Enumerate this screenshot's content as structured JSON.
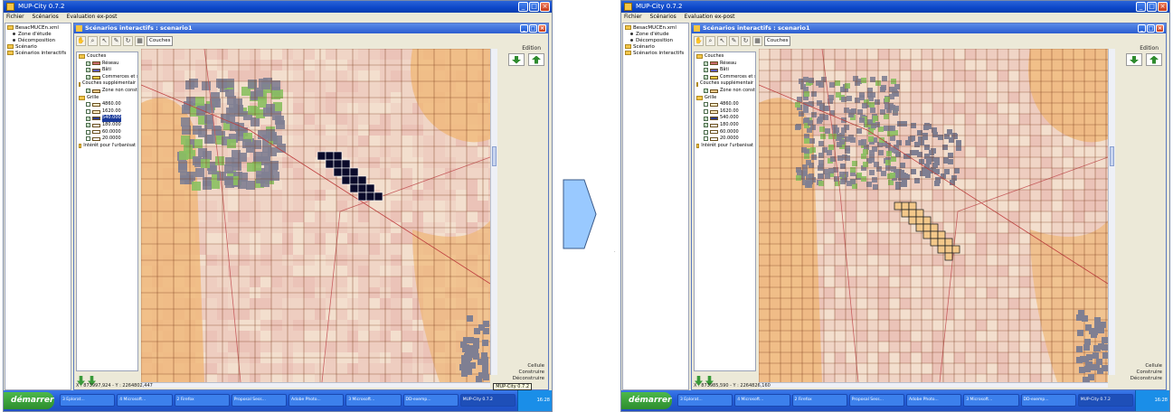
{
  "app": {
    "title": "MUP-City 0.7.2",
    "menu": [
      "Fichier",
      "Scénarios",
      "Evaluation ex-post"
    ]
  },
  "tree": [
    {
      "kind": "folder",
      "label": "BesacMUCEn.xml"
    },
    {
      "kind": "item",
      "label": "Zone d'étude"
    },
    {
      "kind": "item",
      "label": "Décomposition"
    },
    {
      "kind": "folder",
      "label": "Scénario"
    },
    {
      "kind": "folder",
      "label": "Scénarios interactifs"
    }
  ],
  "inner_window": {
    "title": "Scénarios interactifs : scenario1"
  },
  "toolbar": {
    "couches_label": "Couches"
  },
  "layers": [
    {
      "label": "Couches",
      "check": "none",
      "swatch": "folder"
    },
    {
      "label": "Réseau",
      "check": "on",
      "swatch": "#c86a6a"
    },
    {
      "label": "Bâti",
      "check": "on",
      "swatch": "#5a5ab8"
    },
    {
      "label": "Commerces et se",
      "check": "on",
      "swatch": "#e8c840"
    },
    {
      "label": "Couches supplémentair",
      "check": "none",
      "swatch": "folder"
    },
    {
      "label": "Zone non constr.",
      "check": "on",
      "swatch": "#f0c888"
    },
    {
      "label": "Grille",
      "check": "none",
      "swatch": "folder"
    },
    {
      "label": "4860.00",
      "check": "off",
      "swatch": "#fff0c8"
    },
    {
      "label": "1620.00",
      "check": "off",
      "swatch": "#fff0c8"
    },
    {
      "label": "540.000",
      "check": "on",
      "swatch": "#2a3a8a"
    },
    {
      "label": "180.000",
      "check": "on",
      "swatch": "#ffffff"
    },
    {
      "label": "60.0000",
      "check": "off",
      "swatch": "#ffffff"
    },
    {
      "label": "20.0000",
      "check": "off",
      "swatch": "#ffffff"
    },
    {
      "label": "Intérêt pour l'urbanisat",
      "check": "none",
      "swatch": "folder"
    }
  ],
  "edition_label": "Edition",
  "status_labels": [
    "Cellule",
    "Construire",
    "Déconstruire"
  ],
  "left_panel": {
    "coords": "X : 873997,924 - Y : 2264802,447",
    "tooltip": "MUP-City 0.7.2",
    "dark_cells": [
      [
        5,
        6
      ],
      [
        6,
        6
      ],
      [
        7,
        6
      ],
      [
        6,
        7
      ],
      [
        7,
        7
      ],
      [
        8,
        7
      ],
      [
        7,
        8
      ],
      [
        8,
        8
      ],
      [
        9,
        8
      ],
      [
        8,
        9
      ],
      [
        9,
        9
      ],
      [
        10,
        9
      ],
      [
        9,
        10
      ],
      [
        10,
        10
      ],
      [
        11,
        10
      ],
      [
        10,
        11
      ],
      [
        11,
        11
      ],
      [
        12,
        11
      ]
    ],
    "highlight_layer": "540.000"
  },
  "right_panel": {
    "coords": "X : 873985,590 - Y : 2264826,160",
    "tooltip": ""
  },
  "taskbar": {
    "start_label": "démarrer",
    "tasks": [
      "3 Eplorat...",
      "4 Microsoft...",
      "2 Firefox",
      "Proposal Sess...",
      "Adobe Photo...",
      "3 Microsoft...",
      "DD-exemp...",
      "MUP-City 0.7.2"
    ],
    "clock": "16:28"
  },
  "colors": {
    "map_base": "#f2dcc8",
    "grid_line": "#7a3a1a",
    "orange_zone": "#f0b878",
    "built_gray": "#7f7f92",
    "green": "#8ac060",
    "transition_arrow": "#99c9ff"
  }
}
